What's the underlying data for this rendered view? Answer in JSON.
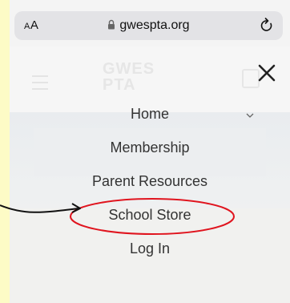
{
  "browser": {
    "text_size_label_small": "A",
    "text_size_label_large": "A",
    "url": "gwespta.org"
  },
  "site": {
    "logo_line1": "GWES",
    "logo_line2": "PTA"
  },
  "menu": {
    "items": [
      {
        "label": "Home"
      },
      {
        "label": "Membership"
      },
      {
        "label": "Parent Resources"
      },
      {
        "label": "School Store"
      },
      {
        "label": "Log In"
      }
    ]
  },
  "annotation": {
    "highlight_color": "#e0141e"
  }
}
